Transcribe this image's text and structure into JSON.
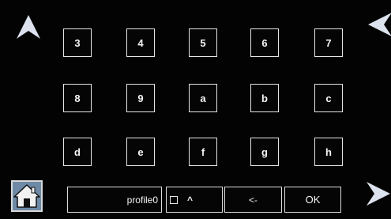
{
  "keypad": {
    "rows": [
      [
        "3",
        "4",
        "5",
        "6",
        "7"
      ],
      [
        "8",
        "9",
        "a",
        "b",
        "c"
      ],
      [
        "d",
        "e",
        "f",
        "g",
        "h"
      ]
    ]
  },
  "bottom_bar": {
    "profile_value": "profile0",
    "shift_label": "^",
    "backspace_label": "<-",
    "ok_label": "OK"
  },
  "icons": {
    "up": "up-arrow-icon",
    "left": "left-arrow-icon",
    "right": "right-arrow-icon",
    "home": "home-icon",
    "shift_checkbox": "checkbox-icon"
  },
  "colors": {
    "background": "#030303",
    "key_border": "#e6e6e6",
    "text": "#f4f4f4",
    "arrow": "#dde3ee",
    "home_bg": "#6e8aa6"
  }
}
